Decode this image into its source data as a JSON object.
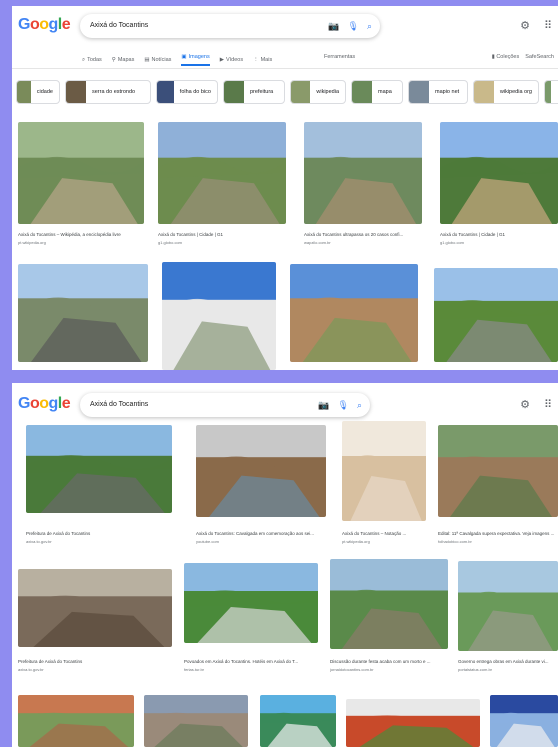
{
  "screen1": {
    "logo": [
      "G",
      "o",
      "o",
      "g",
      "l",
      "e"
    ],
    "query": "Axixá do Tocantins",
    "tabs": [
      {
        "label": "Todas",
        "icon": "search-icon"
      },
      {
        "label": "Mapas",
        "icon": "map-pin-icon"
      },
      {
        "label": "Notícias",
        "icon": "news-icon"
      },
      {
        "label": "Imagens",
        "icon": "image-icon",
        "active": true
      },
      {
        "label": "Vídeos",
        "icon": "video-icon"
      },
      {
        "label": "Mais",
        "icon": "more-dots-icon"
      }
    ],
    "tools_label": "Ferramentas",
    "collections_label": "Coleções",
    "safesearch_label": "SafeSearch",
    "chips": [
      {
        "label": "cidade",
        "color": "#7a8b5a"
      },
      {
        "label": "serra do estrondo",
        "color": "#6b5b45"
      },
      {
        "label": "folha do bico",
        "color": "#3b4f7a"
      },
      {
        "label": "prefeitura",
        "color": "#5a7a4a"
      },
      {
        "label": "wikipedia",
        "color": "#8a9a6a"
      },
      {
        "label": "mapa",
        "color": "#6a8a5a"
      },
      {
        "label": "mapio net",
        "color": "#7a8a9a"
      },
      {
        "label": "wikipedia org",
        "color": "#c9b98a"
      },
      {
        "label": "",
        "color": "#7a9a6a"
      }
    ],
    "results": [
      {
        "caption": "Axixá do Tocantins – Wikipédia, a enciclopédia livre",
        "source": "pt.wikipedia.org",
        "colors": [
          "#9cb78a",
          "#6f8c56",
          "#b8a58a"
        ]
      },
      {
        "caption": "Axixá do Tocantins | Cidade | G1",
        "source": "g1.globo.com",
        "colors": [
          "#8fb0d8",
          "#6d8c4e",
          "#9a8f78"
        ]
      },
      {
        "caption": "Axixá do Tocantins ultrapassa os 20 casos confi...",
        "source": "wapzilo.com.br",
        "colors": [
          "#a3bfdc",
          "#6e8a5e",
          "#a88f70"
        ]
      },
      {
        "caption": "Axixá do Tocantins | Cidade | G1",
        "source": "g1.globo.com",
        "colors": [
          "#8ab4e8",
          "#4e7a3a",
          "#c9a880"
        ]
      },
      {
        "caption": "",
        "source": "",
        "colors": [
          "#a8c8e8",
          "#7a8a6a",
          "#5a5a5a"
        ]
      },
      {
        "caption": "",
        "source": "",
        "colors": [
          "#3a78d0",
          "#e8e8e8",
          "#8a9a7a"
        ]
      },
      {
        "caption": "",
        "source": "",
        "colors": [
          "#5a90d8",
          "#b08860",
          "#7a9a5a"
        ]
      },
      {
        "caption": "",
        "source": "",
        "colors": [
          "#9ac0e8",
          "#5a8a3a",
          "#8a8a8a"
        ]
      }
    ]
  },
  "screen2": {
    "logo": [
      "G",
      "o",
      "o",
      "g",
      "l",
      "e"
    ],
    "query": "Axixá do Tocantins",
    "results": [
      {
        "caption": "Prefeitura de Axixá do Tocantins",
        "source": "axixa.to.gov.br",
        "colors": [
          "#8ab8e0",
          "#4a7a3a",
          "#6a6a6a"
        ]
      },
      {
        "caption": "Axixá do Tocantins: Cavalgada em comemoração aos sei...",
        "source": "youtube.com",
        "colors": [
          "#c8c8c8",
          "#8a6a4a",
          "#6a8aa0"
        ]
      },
      {
        "caption": "Axixá do Tocantins – Notação ...",
        "source": "pt.wikipedia.org",
        "colors": [
          "#f0e8dc",
          "#d8c0a0",
          "#e8d8c8"
        ]
      },
      {
        "caption": "Edital: 11ª Cavalgada supera expectativa. Veja imagens ...",
        "source": "folhadobico.com.br",
        "colors": [
          "#7a9a6a",
          "#9a7a5a",
          "#5a7a4a"
        ]
      },
      {
        "caption": "Prefeitura de Axixá do Tocantins",
        "source": "axixa.to.gov.br",
        "colors": [
          "#b8b0a0",
          "#7a6a5a",
          "#5a4a3a"
        ]
      },
      {
        "caption": "Povoados em Axixá do Tocantins. Hotéis em Axixá do T...",
        "source": "ferias.tur.br",
        "colors": [
          "#8ab8e0",
          "#4a8a3a",
          "#d8d8d8"
        ]
      },
      {
        "caption": "Discussão durante festa acaba com um morto e ...",
        "source": "jornaldotocantins.com.br",
        "colors": [
          "#9abcd8",
          "#5a8a4a",
          "#8a7a6a"
        ]
      },
      {
        "caption": "Governo entrega obras em Axixá durante vi...",
        "source": "portalstatus.com.br",
        "colors": [
          "#a8c8e0",
          "#6a9a5a",
          "#9a9a8a"
        ]
      },
      {
        "caption": "",
        "source": "",
        "colors": [
          "#c87850",
          "#7a9a5a",
          "#a86848"
        ]
      },
      {
        "caption": "",
        "source": "",
        "colors": [
          "#8a9ab0",
          "#9a8a7a",
          "#6a7a5a"
        ]
      },
      {
        "caption": "",
        "source": "",
        "colors": [
          "#5ab0e0",
          "#3a8a5a",
          "#f0f0f0"
        ]
      },
      {
        "caption": "",
        "source": "",
        "colors": [
          "#e8e8e8",
          "#c84a2a",
          "#4a8a3a"
        ]
      },
      {
        "caption": "",
        "source": "",
        "colors": [
          "#2a4aa0",
          "#8ab0e0",
          "#f0f0f0"
        ]
      }
    ]
  }
}
